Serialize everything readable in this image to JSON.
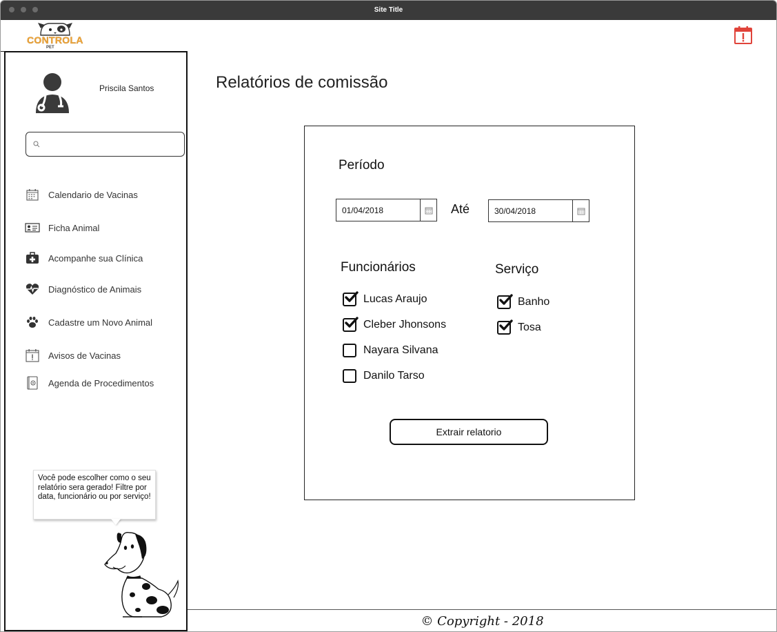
{
  "window": {
    "title": "Site Title"
  },
  "header": {
    "logo_text": "CONTROLA",
    "logo_sub": "PET",
    "alert_icon": "calendar-alert-icon",
    "accent_color": "#e0433a"
  },
  "sidebar": {
    "user_name": "Priscila Santos",
    "search": {
      "placeholder": "",
      "value": ""
    },
    "items": [
      {
        "label": "Calendario de Vacinas",
        "icon": "calendar-icon"
      },
      {
        "label": "Ficha Animal",
        "icon": "id-card-icon"
      },
      {
        "label": "Acompanhe sua Clínica",
        "icon": "medical-bag-icon"
      },
      {
        "label": "Diagnóstico de Animais",
        "icon": "heartbeat-icon"
      },
      {
        "label": "Cadastre um Novo Animal",
        "icon": "paw-icon"
      },
      {
        "label": "Avisos de Vacinas",
        "icon": "calendar-alert-icon"
      },
      {
        "label": "Agenda de Procedimentos",
        "icon": "agenda-icon"
      }
    ],
    "tip": "Você pode escolher como  o seu relatório sera gerado! Filtre por data, funcionário ou por serviço!"
  },
  "main": {
    "title": "Relatórios de comissão",
    "period": {
      "label": "Período",
      "from": "01/04/2018",
      "separator": "Até",
      "to": "30/04/2018"
    },
    "employees": {
      "label": "Funcionários",
      "items": [
        {
          "name": "Lucas Araujo",
          "checked": true
        },
        {
          "name": "Cleber Jhonsons",
          "checked": true
        },
        {
          "name": "Nayara Silvana",
          "checked": false
        },
        {
          "name": "Danilo Tarso",
          "checked": false
        }
      ]
    },
    "services": {
      "label": "Serviço",
      "items": [
        {
          "name": "Banho",
          "checked": true
        },
        {
          "name": "Tosa",
          "checked": true
        }
      ]
    },
    "extract_button": "Extrair relatorio"
  },
  "footer": {
    "text": "© Copyright - 2018"
  }
}
